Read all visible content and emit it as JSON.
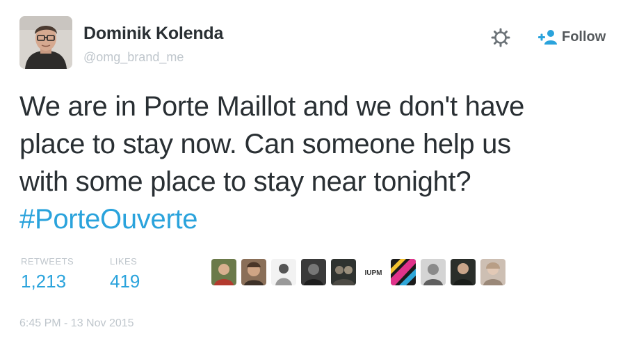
{
  "author": {
    "display_name": "Dominik Kolenda",
    "handle": "@omg_brand_me"
  },
  "actions": {
    "settings_icon": "gear-icon",
    "follow_icon": "add-user-icon",
    "follow_label": "Follow"
  },
  "tweet": {
    "lines": [
      "We are in Porte Maillot and we don't have",
      "place to stay now. Can someone help us",
      "with some place to stay near tonight?"
    ],
    "hashtag": "#PorteOuverte"
  },
  "stats": {
    "retweets_label": "RETWEETS",
    "retweets_value": "1,213",
    "likes_label": "LIKES",
    "likes_value": "419"
  },
  "likers_count_shown": 10,
  "timestamp": "6:45 PM - 13 Nov 2015",
  "colors": {
    "link": "#2aa3dc",
    "text": "#292f33",
    "muted": "#bfc6cc"
  }
}
